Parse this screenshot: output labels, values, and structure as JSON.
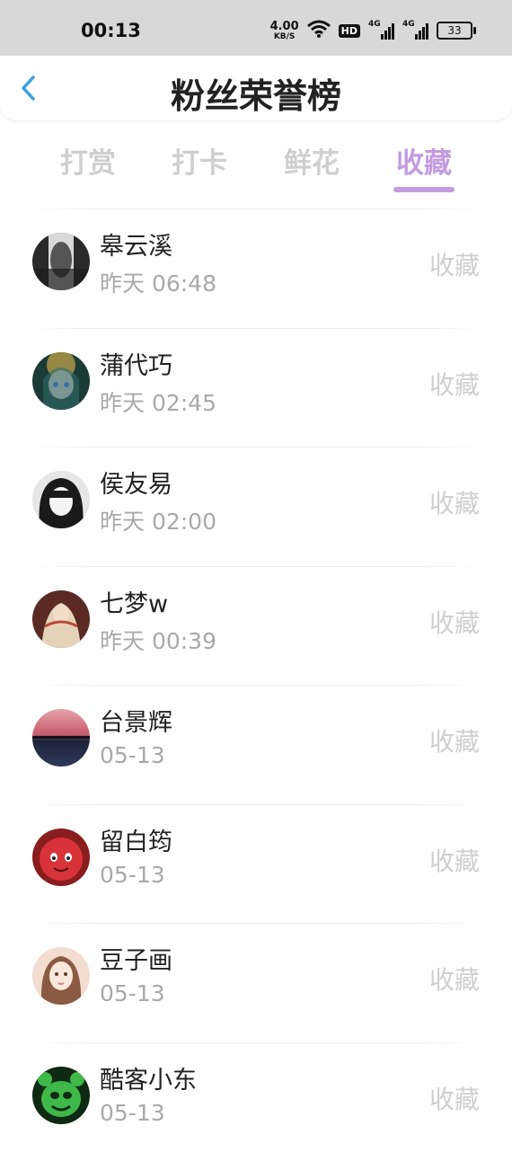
{
  "status_bar": {
    "time": "00:13",
    "net_speed_value": "4.00",
    "net_speed_unit": "KB/S",
    "hd_label": "HD",
    "signal_1_label": "4G",
    "signal_2_label": "4G",
    "battery": "33"
  },
  "header": {
    "back_icon": "chevron-left-icon",
    "title": "粉丝荣誉榜"
  },
  "tabs": [
    {
      "label": "打赏",
      "active": false
    },
    {
      "label": "打卡",
      "active": false
    },
    {
      "label": "鲜花",
      "active": false
    },
    {
      "label": "收藏",
      "active": true
    }
  ],
  "colors": {
    "accent": "#c39be0",
    "inactive_tab": "#cfcfcf",
    "back_arrow": "#3aa0e6"
  },
  "list": [
    {
      "name": "皋云溪",
      "time": "昨天 06:48",
      "action": "收藏"
    },
    {
      "name": "蒲代巧",
      "time": "昨天 02:45",
      "action": "收藏"
    },
    {
      "name": "侯友易",
      "time": "昨天 02:00",
      "action": "收藏"
    },
    {
      "name": "七梦w",
      "time": "昨天 00:39",
      "action": "收藏"
    },
    {
      "name": "台景辉",
      "time": "05-13",
      "action": "收藏"
    },
    {
      "name": "留白筠",
      "time": "05-13",
      "action": "收藏"
    },
    {
      "name": "豆子画",
      "time": "05-13",
      "action": "收藏"
    },
    {
      "name": "酷客小东",
      "time": "05-13",
      "action": "收藏"
    }
  ]
}
